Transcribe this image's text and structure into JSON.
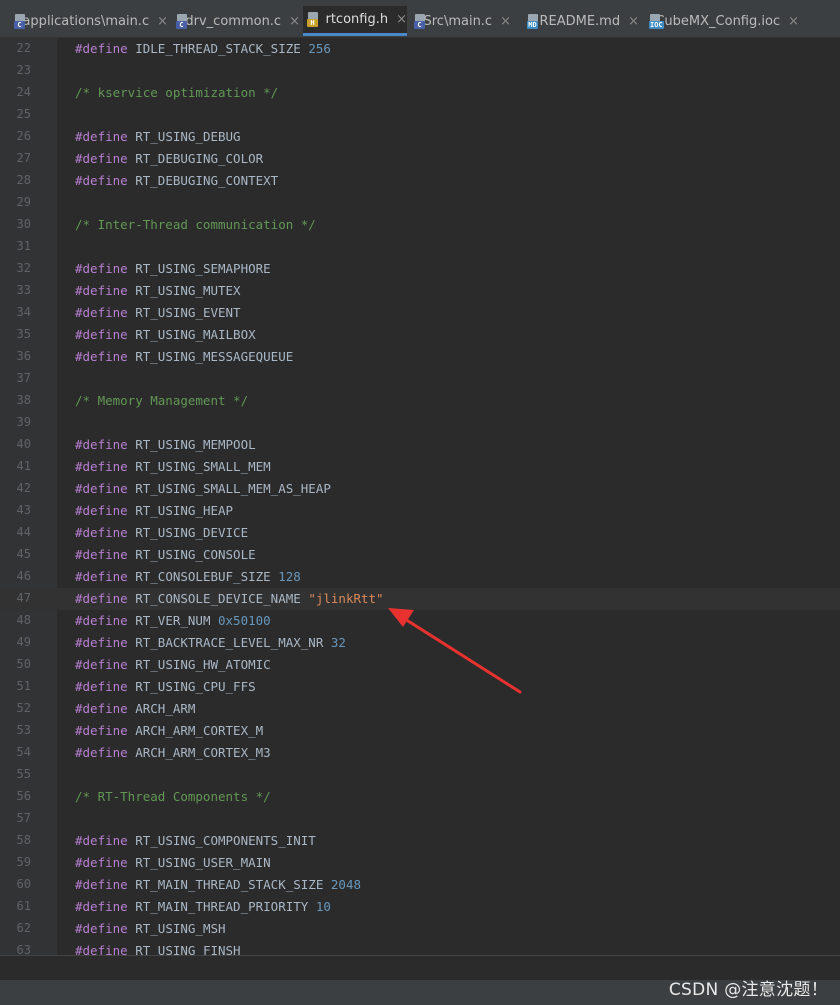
{
  "tabs": [
    {
      "label": "applications\\main.c",
      "icon": "c-file-icon",
      "badge": "C",
      "badge_color": "#4a5fa8"
    },
    {
      "label": "drv_common.c",
      "icon": "c-file-icon",
      "badge": "C",
      "badge_color": "#4a5fa8"
    },
    {
      "label": "rtconfig.h",
      "icon": "h-file-icon",
      "badge": "H",
      "badge_color": "#c7a12a",
      "active": true
    },
    {
      "label": "Src\\main.c",
      "icon": "c-file-icon",
      "badge": "C",
      "badge_color": "#4a5fa8"
    },
    {
      "label": "README.md",
      "icon": "markdown-file-icon",
      "badge": "MD",
      "badge_color": "#3d8cc4"
    },
    {
      "label": "CubeMX_Config.ioc",
      "icon": "ioc-file-icon",
      "badge": "IOC",
      "badge_color": "#3d8cc4"
    }
  ],
  "close_glyph": "×",
  "current_line": 47,
  "lines": [
    {
      "n": "22",
      "t": [
        [
          "kw",
          "#define"
        ],
        [
          "id",
          " IDLE_THREAD_STACK_SIZE "
        ],
        [
          "num",
          "256"
        ]
      ]
    },
    {
      "n": "23",
      "t": []
    },
    {
      "n": "24",
      "t": [
        [
          "cmt",
          "/* kservice optimization */"
        ]
      ]
    },
    {
      "n": "25",
      "t": []
    },
    {
      "n": "26",
      "t": [
        [
          "kw",
          "#define"
        ],
        [
          "id",
          " RT_USING_DEBUG"
        ]
      ]
    },
    {
      "n": "27",
      "t": [
        [
          "kw",
          "#define"
        ],
        [
          "id",
          " RT_DEBUGING_COLOR"
        ]
      ]
    },
    {
      "n": "28",
      "t": [
        [
          "kw",
          "#define"
        ],
        [
          "id",
          " RT_DEBUGING_CONTEXT"
        ]
      ]
    },
    {
      "n": "29",
      "t": []
    },
    {
      "n": "30",
      "t": [
        [
          "cmt",
          "/* Inter-Thread communication */"
        ]
      ]
    },
    {
      "n": "31",
      "t": []
    },
    {
      "n": "32",
      "t": [
        [
          "kw",
          "#define"
        ],
        [
          "id",
          " RT_USING_SEMAPHORE"
        ]
      ]
    },
    {
      "n": "33",
      "t": [
        [
          "kw",
          "#define"
        ],
        [
          "id",
          " RT_USING_MUTEX"
        ]
      ]
    },
    {
      "n": "34",
      "t": [
        [
          "kw",
          "#define"
        ],
        [
          "id",
          " RT_USING_EVENT"
        ]
      ]
    },
    {
      "n": "35",
      "t": [
        [
          "kw",
          "#define"
        ],
        [
          "id",
          " RT_USING_MAILBOX"
        ]
      ]
    },
    {
      "n": "36",
      "t": [
        [
          "kw",
          "#define"
        ],
        [
          "id",
          " RT_USING_MESSAGEQUEUE"
        ]
      ]
    },
    {
      "n": "37",
      "t": []
    },
    {
      "n": "38",
      "t": [
        [
          "cmt",
          "/* Memory Management */"
        ]
      ]
    },
    {
      "n": "39",
      "t": []
    },
    {
      "n": "40",
      "t": [
        [
          "kw",
          "#define"
        ],
        [
          "id",
          " RT_USING_MEMPOOL"
        ]
      ]
    },
    {
      "n": "41",
      "t": [
        [
          "kw",
          "#define"
        ],
        [
          "id",
          " RT_USING_SMALL_MEM"
        ]
      ]
    },
    {
      "n": "42",
      "t": [
        [
          "kw",
          "#define"
        ],
        [
          "id",
          " RT_USING_SMALL_MEM_AS_HEAP"
        ]
      ]
    },
    {
      "n": "43",
      "t": [
        [
          "kw",
          "#define"
        ],
        [
          "id",
          " RT_USING_HEAP"
        ]
      ]
    },
    {
      "n": "44",
      "t": [
        [
          "kw",
          "#define"
        ],
        [
          "id",
          " RT_USING_DEVICE"
        ]
      ]
    },
    {
      "n": "45",
      "t": [
        [
          "kw",
          "#define"
        ],
        [
          "id",
          " RT_USING_CONSOLE"
        ]
      ]
    },
    {
      "n": "46",
      "t": [
        [
          "kw",
          "#define"
        ],
        [
          "id",
          " RT_CONSOLEBUF_SIZE "
        ],
        [
          "num",
          "128"
        ]
      ]
    },
    {
      "n": "47",
      "t": [
        [
          "kw",
          "#define"
        ],
        [
          "id",
          " RT_CONSOLE_DEVICE_NAME "
        ],
        [
          "str",
          "\"jlinkRtt\""
        ]
      ]
    },
    {
      "n": "48",
      "t": [
        [
          "kw",
          "#define"
        ],
        [
          "id",
          " RT_VER_NUM "
        ],
        [
          "num",
          "0x50100"
        ]
      ]
    },
    {
      "n": "49",
      "t": [
        [
          "kw",
          "#define"
        ],
        [
          "id",
          " RT_BACKTRACE_LEVEL_MAX_NR "
        ],
        [
          "num",
          "32"
        ]
      ]
    },
    {
      "n": "50",
      "t": [
        [
          "kw",
          "#define"
        ],
        [
          "id",
          " RT_USING_HW_ATOMIC"
        ]
      ]
    },
    {
      "n": "51",
      "t": [
        [
          "kw",
          "#define"
        ],
        [
          "id",
          " RT_USING_CPU_FFS"
        ]
      ]
    },
    {
      "n": "52",
      "t": [
        [
          "kw",
          "#define"
        ],
        [
          "id",
          " ARCH_ARM"
        ]
      ]
    },
    {
      "n": "53",
      "t": [
        [
          "kw",
          "#define"
        ],
        [
          "id",
          " ARCH_ARM_CORTEX_M"
        ]
      ]
    },
    {
      "n": "54",
      "t": [
        [
          "kw",
          "#define"
        ],
        [
          "id",
          " ARCH_ARM_CORTEX_M3"
        ]
      ]
    },
    {
      "n": "55",
      "t": []
    },
    {
      "n": "56",
      "t": [
        [
          "cmt",
          "/* RT-Thread Components */"
        ]
      ]
    },
    {
      "n": "57",
      "t": []
    },
    {
      "n": "58",
      "t": [
        [
          "kw",
          "#define"
        ],
        [
          "id",
          " RT_USING_COMPONENTS_INIT"
        ]
      ]
    },
    {
      "n": "59",
      "t": [
        [
          "kw",
          "#define"
        ],
        [
          "id",
          " RT_USING_USER_MAIN"
        ]
      ]
    },
    {
      "n": "60",
      "t": [
        [
          "kw",
          "#define"
        ],
        [
          "id",
          " RT_MAIN_THREAD_STACK_SIZE "
        ],
        [
          "num",
          "2048"
        ]
      ]
    },
    {
      "n": "61",
      "t": [
        [
          "kw",
          "#define"
        ],
        [
          "id",
          " RT_MAIN_THREAD_PRIORITY "
        ],
        [
          "num",
          "10"
        ]
      ]
    },
    {
      "n": "62",
      "t": [
        [
          "kw",
          "#define"
        ],
        [
          "id",
          " RT_USING_MSH"
        ]
      ]
    },
    {
      "n": "63",
      "t": [
        [
          "kw",
          "#define"
        ],
        [
          "id",
          " RT_USING_FINSH"
        ]
      ]
    }
  ],
  "annotation": {
    "icon": "red-arrow-icon",
    "color": "#e8322f",
    "points_to_line": 47
  },
  "watermark": "CSDN @注意沈题！"
}
